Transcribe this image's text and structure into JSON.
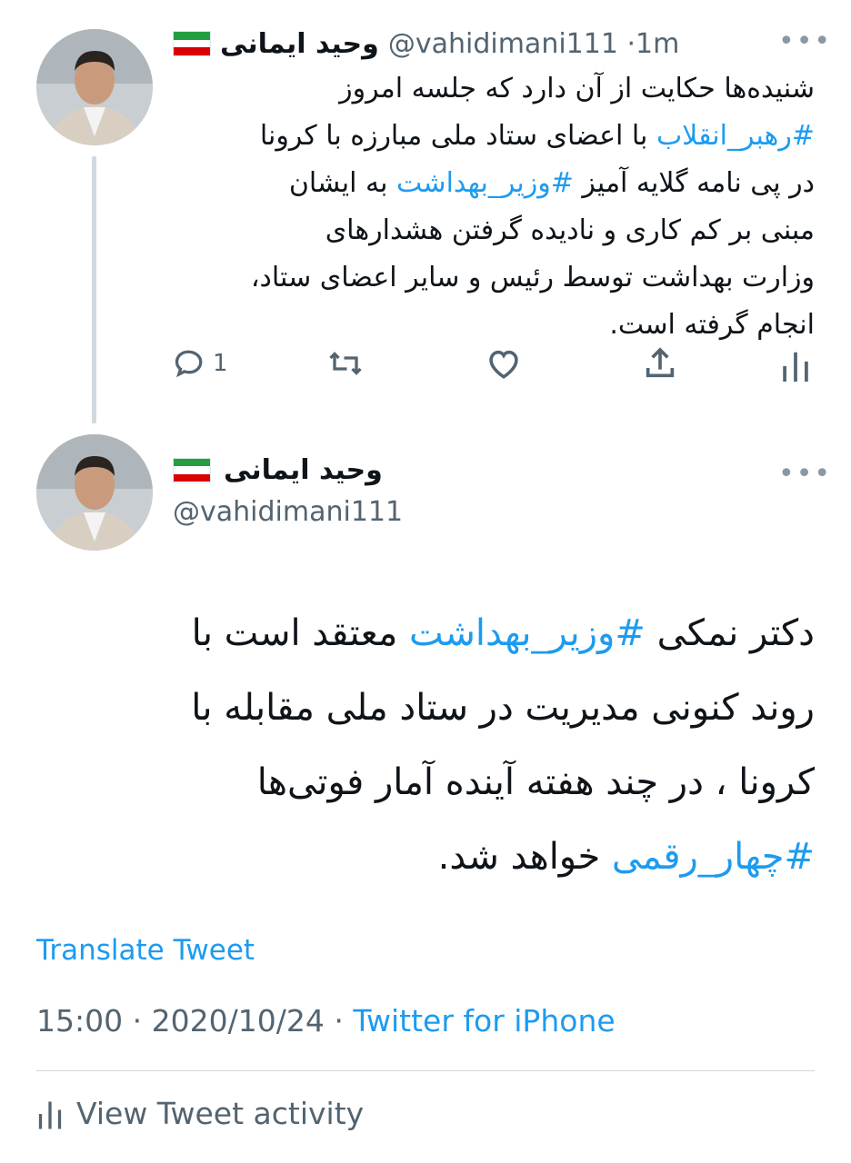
{
  "tweet1": {
    "name": "وحید ایمانی",
    "handle": "@vahidimani111",
    "sep": "·",
    "time": "1m",
    "text": [
      {
        "t": "شنیده‌ها حکایت از آن دارد که جلسه امروز"
      },
      {
        "h": "#رهبر_انقلاب",
        "t": " با اعضای ستاد ملی مبارزه با کرونا"
      },
      {
        "t": "در پی نامه گلایه آمیز ",
        "h": "#وزیر_بهداشت",
        "t2": "  به ایشان"
      },
      {
        "t": "مبنی بر کم کاری و نادیده گرفتن هشدارهای"
      },
      {
        "t": "وزارت بهداشت توسط رئیس و سایر اعضای ستاد،"
      },
      {
        "t": "انجام گرفته است."
      }
    ],
    "actions": {
      "reply_count": "1",
      "reply_icon": "reply-icon",
      "retweet_icon": "retweet-icon",
      "like_icon": "heart-icon",
      "share_icon": "share-icon",
      "analytics_icon": "analytics-icon"
    }
  },
  "tweet2": {
    "name": "وحید ایمانی",
    "handle": "@vahidimani111",
    "text_lines": [
      {
        "pre": "دکتر نمکی ",
        "h": "#وزیر_بهداشت",
        "post": " معتقد است با"
      },
      {
        "pre": "روند کنونی مدیریت در ستاد ملی مقابله با"
      },
      {
        "pre": "کرونا ، در چند هفته آینده آمار فوتی‌ها"
      },
      {
        "h": "#چهار_رقمی",
        "post": " خواهد شد."
      }
    ],
    "translate": "Translate Tweet",
    "time": "15:00",
    "date": "2020/10/24",
    "sep": "·",
    "client": "Twitter for iPhone",
    "activity": "View Tweet activity"
  },
  "colors": {
    "accent": "#1d9bf0",
    "text": "#0f1419",
    "muted": "#536471"
  }
}
